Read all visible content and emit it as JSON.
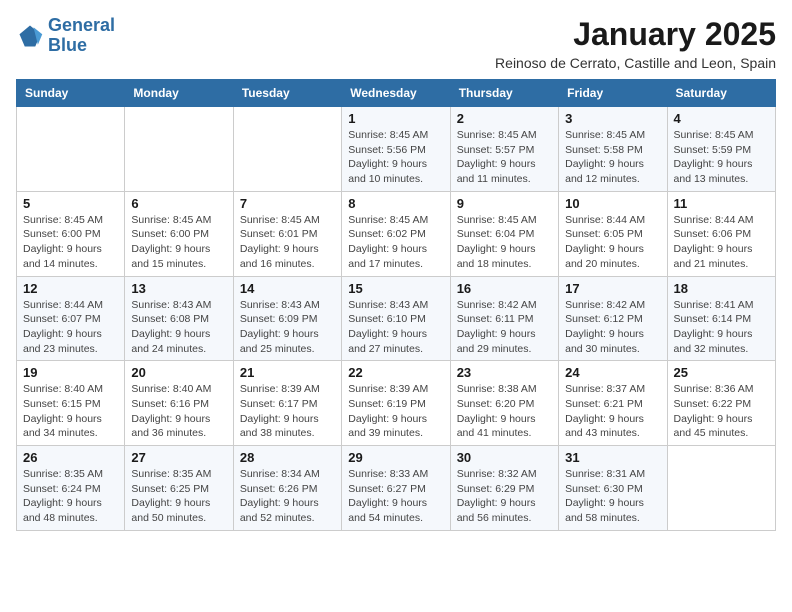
{
  "logo": {
    "line1": "General",
    "line2": "Blue"
  },
  "title": "January 2025",
  "subtitle": "Reinoso de Cerrato, Castille and Leon, Spain",
  "weekdays": [
    "Sunday",
    "Monday",
    "Tuesday",
    "Wednesday",
    "Thursday",
    "Friday",
    "Saturday"
  ],
  "weeks": [
    [
      {
        "day": "",
        "info": ""
      },
      {
        "day": "",
        "info": ""
      },
      {
        "day": "",
        "info": ""
      },
      {
        "day": "1",
        "info": "Sunrise: 8:45 AM\nSunset: 5:56 PM\nDaylight: 9 hours\nand 10 minutes."
      },
      {
        "day": "2",
        "info": "Sunrise: 8:45 AM\nSunset: 5:57 PM\nDaylight: 9 hours\nand 11 minutes."
      },
      {
        "day": "3",
        "info": "Sunrise: 8:45 AM\nSunset: 5:58 PM\nDaylight: 9 hours\nand 12 minutes."
      },
      {
        "day": "4",
        "info": "Sunrise: 8:45 AM\nSunset: 5:59 PM\nDaylight: 9 hours\nand 13 minutes."
      }
    ],
    [
      {
        "day": "5",
        "info": "Sunrise: 8:45 AM\nSunset: 6:00 PM\nDaylight: 9 hours\nand 14 minutes."
      },
      {
        "day": "6",
        "info": "Sunrise: 8:45 AM\nSunset: 6:00 PM\nDaylight: 9 hours\nand 15 minutes."
      },
      {
        "day": "7",
        "info": "Sunrise: 8:45 AM\nSunset: 6:01 PM\nDaylight: 9 hours\nand 16 minutes."
      },
      {
        "day": "8",
        "info": "Sunrise: 8:45 AM\nSunset: 6:02 PM\nDaylight: 9 hours\nand 17 minutes."
      },
      {
        "day": "9",
        "info": "Sunrise: 8:45 AM\nSunset: 6:04 PM\nDaylight: 9 hours\nand 18 minutes."
      },
      {
        "day": "10",
        "info": "Sunrise: 8:44 AM\nSunset: 6:05 PM\nDaylight: 9 hours\nand 20 minutes."
      },
      {
        "day": "11",
        "info": "Sunrise: 8:44 AM\nSunset: 6:06 PM\nDaylight: 9 hours\nand 21 minutes."
      }
    ],
    [
      {
        "day": "12",
        "info": "Sunrise: 8:44 AM\nSunset: 6:07 PM\nDaylight: 9 hours\nand 23 minutes."
      },
      {
        "day": "13",
        "info": "Sunrise: 8:43 AM\nSunset: 6:08 PM\nDaylight: 9 hours\nand 24 minutes."
      },
      {
        "day": "14",
        "info": "Sunrise: 8:43 AM\nSunset: 6:09 PM\nDaylight: 9 hours\nand 25 minutes."
      },
      {
        "day": "15",
        "info": "Sunrise: 8:43 AM\nSunset: 6:10 PM\nDaylight: 9 hours\nand 27 minutes."
      },
      {
        "day": "16",
        "info": "Sunrise: 8:42 AM\nSunset: 6:11 PM\nDaylight: 9 hours\nand 29 minutes."
      },
      {
        "day": "17",
        "info": "Sunrise: 8:42 AM\nSunset: 6:12 PM\nDaylight: 9 hours\nand 30 minutes."
      },
      {
        "day": "18",
        "info": "Sunrise: 8:41 AM\nSunset: 6:14 PM\nDaylight: 9 hours\nand 32 minutes."
      }
    ],
    [
      {
        "day": "19",
        "info": "Sunrise: 8:40 AM\nSunset: 6:15 PM\nDaylight: 9 hours\nand 34 minutes."
      },
      {
        "day": "20",
        "info": "Sunrise: 8:40 AM\nSunset: 6:16 PM\nDaylight: 9 hours\nand 36 minutes."
      },
      {
        "day": "21",
        "info": "Sunrise: 8:39 AM\nSunset: 6:17 PM\nDaylight: 9 hours\nand 38 minutes."
      },
      {
        "day": "22",
        "info": "Sunrise: 8:39 AM\nSunset: 6:19 PM\nDaylight: 9 hours\nand 39 minutes."
      },
      {
        "day": "23",
        "info": "Sunrise: 8:38 AM\nSunset: 6:20 PM\nDaylight: 9 hours\nand 41 minutes."
      },
      {
        "day": "24",
        "info": "Sunrise: 8:37 AM\nSunset: 6:21 PM\nDaylight: 9 hours\nand 43 minutes."
      },
      {
        "day": "25",
        "info": "Sunrise: 8:36 AM\nSunset: 6:22 PM\nDaylight: 9 hours\nand 45 minutes."
      }
    ],
    [
      {
        "day": "26",
        "info": "Sunrise: 8:35 AM\nSunset: 6:24 PM\nDaylight: 9 hours\nand 48 minutes."
      },
      {
        "day": "27",
        "info": "Sunrise: 8:35 AM\nSunset: 6:25 PM\nDaylight: 9 hours\nand 50 minutes."
      },
      {
        "day": "28",
        "info": "Sunrise: 8:34 AM\nSunset: 6:26 PM\nDaylight: 9 hours\nand 52 minutes."
      },
      {
        "day": "29",
        "info": "Sunrise: 8:33 AM\nSunset: 6:27 PM\nDaylight: 9 hours\nand 54 minutes."
      },
      {
        "day": "30",
        "info": "Sunrise: 8:32 AM\nSunset: 6:29 PM\nDaylight: 9 hours\nand 56 minutes."
      },
      {
        "day": "31",
        "info": "Sunrise: 8:31 AM\nSunset: 6:30 PM\nDaylight: 9 hours\nand 58 minutes."
      },
      {
        "day": "",
        "info": ""
      }
    ]
  ]
}
